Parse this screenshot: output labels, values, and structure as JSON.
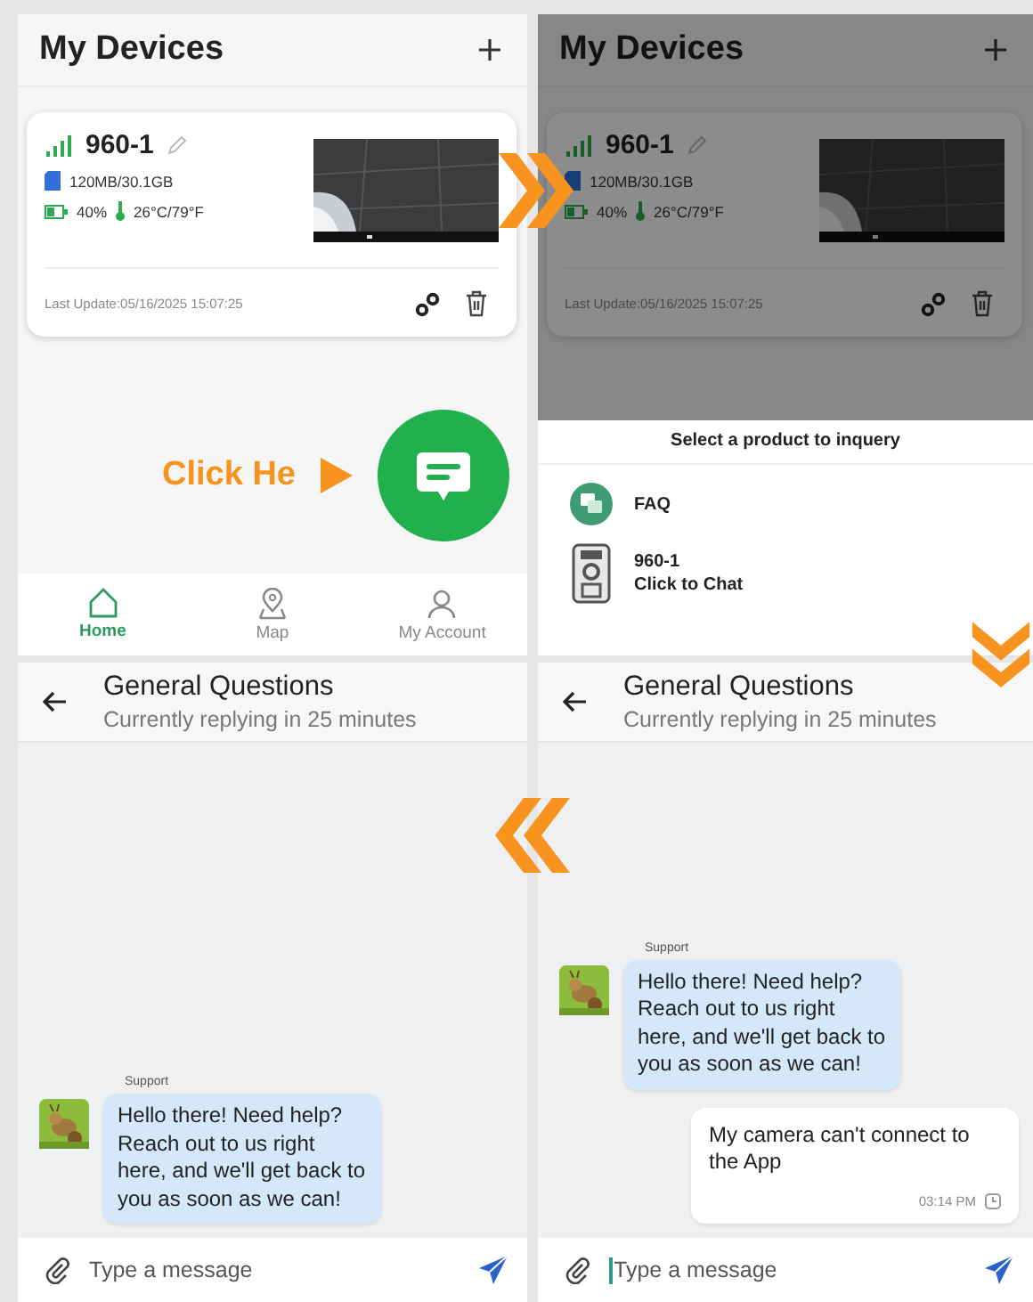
{
  "panels": [
    {
      "kind": "devices",
      "title": "My Devices",
      "device": {
        "name": "960-1",
        "storage": "120MB/30.1GB",
        "battery": "40%",
        "temperature": "26°C/79°F",
        "last_update": "Last Update:05/16/2025 15:07:25"
      },
      "callout": "Click He",
      "nav": [
        {
          "label": "Home",
          "kind": "home",
          "selected": true
        },
        {
          "label": "Map",
          "kind": "map",
          "selected": false
        },
        {
          "label": "My Account",
          "kind": "account",
          "selected": false
        }
      ],
      "dimmed": false
    },
    {
      "kind": "devices",
      "title": "My Devices",
      "device": {
        "name": "960-1",
        "storage": "120MB/30.1GB",
        "battery": "40%",
        "temperature": "26°C/79°F",
        "last_update": "Last Update:05/16/2025 15:07:25"
      },
      "dimmed": true,
      "sheet": {
        "title": "Select a product to inquery",
        "items": [
          {
            "kind": "faq",
            "label": "FAQ"
          },
          {
            "kind": "device",
            "label": "960-1",
            "sublabel": "Click to Chat"
          }
        ]
      }
    },
    {
      "kind": "chat",
      "title": "General Questions",
      "subtitle": "Currently replying in 25 minutes",
      "messages": [
        {
          "kind": "incoming",
          "sender": "Support",
          "text": "Hello there! Need help? Reach out to us right here, and we'll get back to you as soon as we can!"
        }
      ],
      "input": {
        "placeholder": "Type a message",
        "focused": false
      }
    },
    {
      "kind": "chat",
      "title": "General Questions",
      "subtitle": "Currently replying in 25 minutes",
      "messages": [
        {
          "kind": "incoming",
          "sender": "Support",
          "text": "Hello there! Need help? Reach out to us right here, and we'll get back to you as soon as we can!"
        },
        {
          "kind": "outgoing",
          "text": "My camera can't connect to the App",
          "time": "03:14 PM"
        }
      ],
      "input": {
        "placeholder": "Type a message",
        "focused": true
      }
    }
  ]
}
